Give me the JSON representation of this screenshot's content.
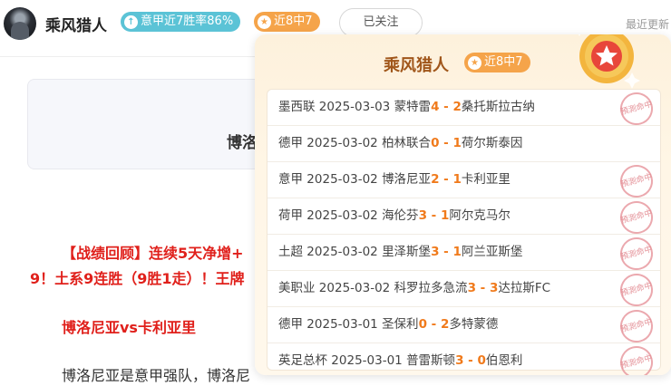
{
  "header": {
    "username": "乘风猎人",
    "rate_badge": "意甲近7胜率86%",
    "rate_icon": "arrow-up-icon",
    "streak_badge": "近8中7",
    "follow_label": "已关注",
    "recent_label": "最近更新"
  },
  "article": {
    "card_title": "博洛",
    "para1": "【战绩回顾】连续5天净增+",
    "para2": "9！土系9连胜（9胜1走）！王牌",
    "para3": "博洛尼亚vs卡利亚里",
    "para4": "博洛尼亚是意甲强队，博洛尼"
  },
  "popup": {
    "title": "乘风猎人",
    "streak_badge": "近8中7",
    "stamp_text": "預測命中",
    "colors": {
      "score": "#f07a1b",
      "stamp": "#e07f87",
      "title": "#a0561a"
    },
    "matches": [
      {
        "league": "墨西联",
        "date": "2025-03-03",
        "home": "蒙特雷",
        "hs": "4",
        "as": "2",
        "away": "桑托斯拉古纳",
        "hit": true
      },
      {
        "league": "德甲",
        "date": "2025-03-02",
        "home": "柏林联合",
        "hs": "0",
        "as": "1",
        "away": "荷尔斯泰因",
        "hit": false
      },
      {
        "league": "意甲",
        "date": "2025-03-02",
        "home": "博洛尼亚",
        "hs": "2",
        "as": "1",
        "away": "卡利亚里",
        "hit": true
      },
      {
        "league": "荷甲",
        "date": "2025-03-02",
        "home": "海伦芬",
        "hs": "3",
        "as": "1",
        "away": "阿尔克马尔",
        "hit": true
      },
      {
        "league": "土超",
        "date": "2025-03-02",
        "home": "里泽斯堡",
        "hs": "3",
        "as": "1",
        "away": "阿兰亚斯堡",
        "hit": true
      },
      {
        "league": "美职业",
        "date": "2025-03-02",
        "home": "科罗拉多急流",
        "hs": "3",
        "as": "3",
        "away": "达拉斯FC",
        "hit": true
      },
      {
        "league": "德甲",
        "date": "2025-03-01",
        "home": "圣保利",
        "hs": "0",
        "as": "2",
        "away": "多特蒙德",
        "hit": true
      },
      {
        "league": "英足总杯",
        "date": "2025-03-01",
        "home": "普雷斯顿",
        "hs": "3",
        "as": "0",
        "away": "伯恩利",
        "hit": true
      }
    ]
  }
}
